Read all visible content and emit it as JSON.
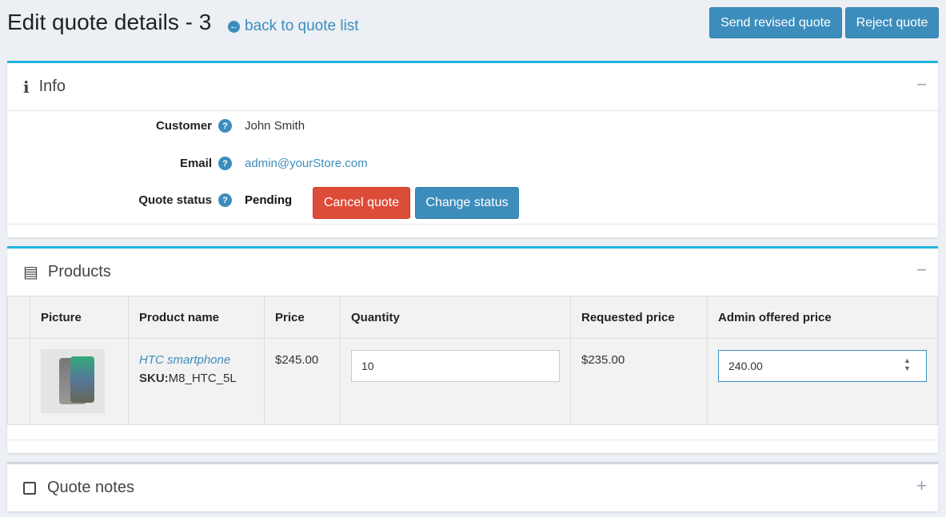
{
  "header": {
    "title": "Edit quote details - 3",
    "back_link": "back to quote list",
    "send_revised": "Send revised quote",
    "reject": "Reject quote"
  },
  "info": {
    "title": "Info",
    "customer_label": "Customer",
    "customer": "John Smith",
    "email_label": "Email",
    "email": "admin@yourStore.com",
    "status_label": "Quote status",
    "status": "Pending",
    "cancel": "Cancel quote",
    "change_status": "Change status"
  },
  "products": {
    "title": "Products",
    "columns": [
      "Picture",
      "Product name",
      "Price",
      "Quantity",
      "Requested price",
      "Admin offered price"
    ],
    "rows": [
      {
        "name": "HTC smartphone",
        "sku_label": "SKU:",
        "sku": "M8_HTC_5L",
        "price": "$245.00",
        "quantity": "10",
        "requested": "$235.00",
        "offered": "240.00"
      }
    ]
  },
  "notes": {
    "title": "Quote notes"
  }
}
